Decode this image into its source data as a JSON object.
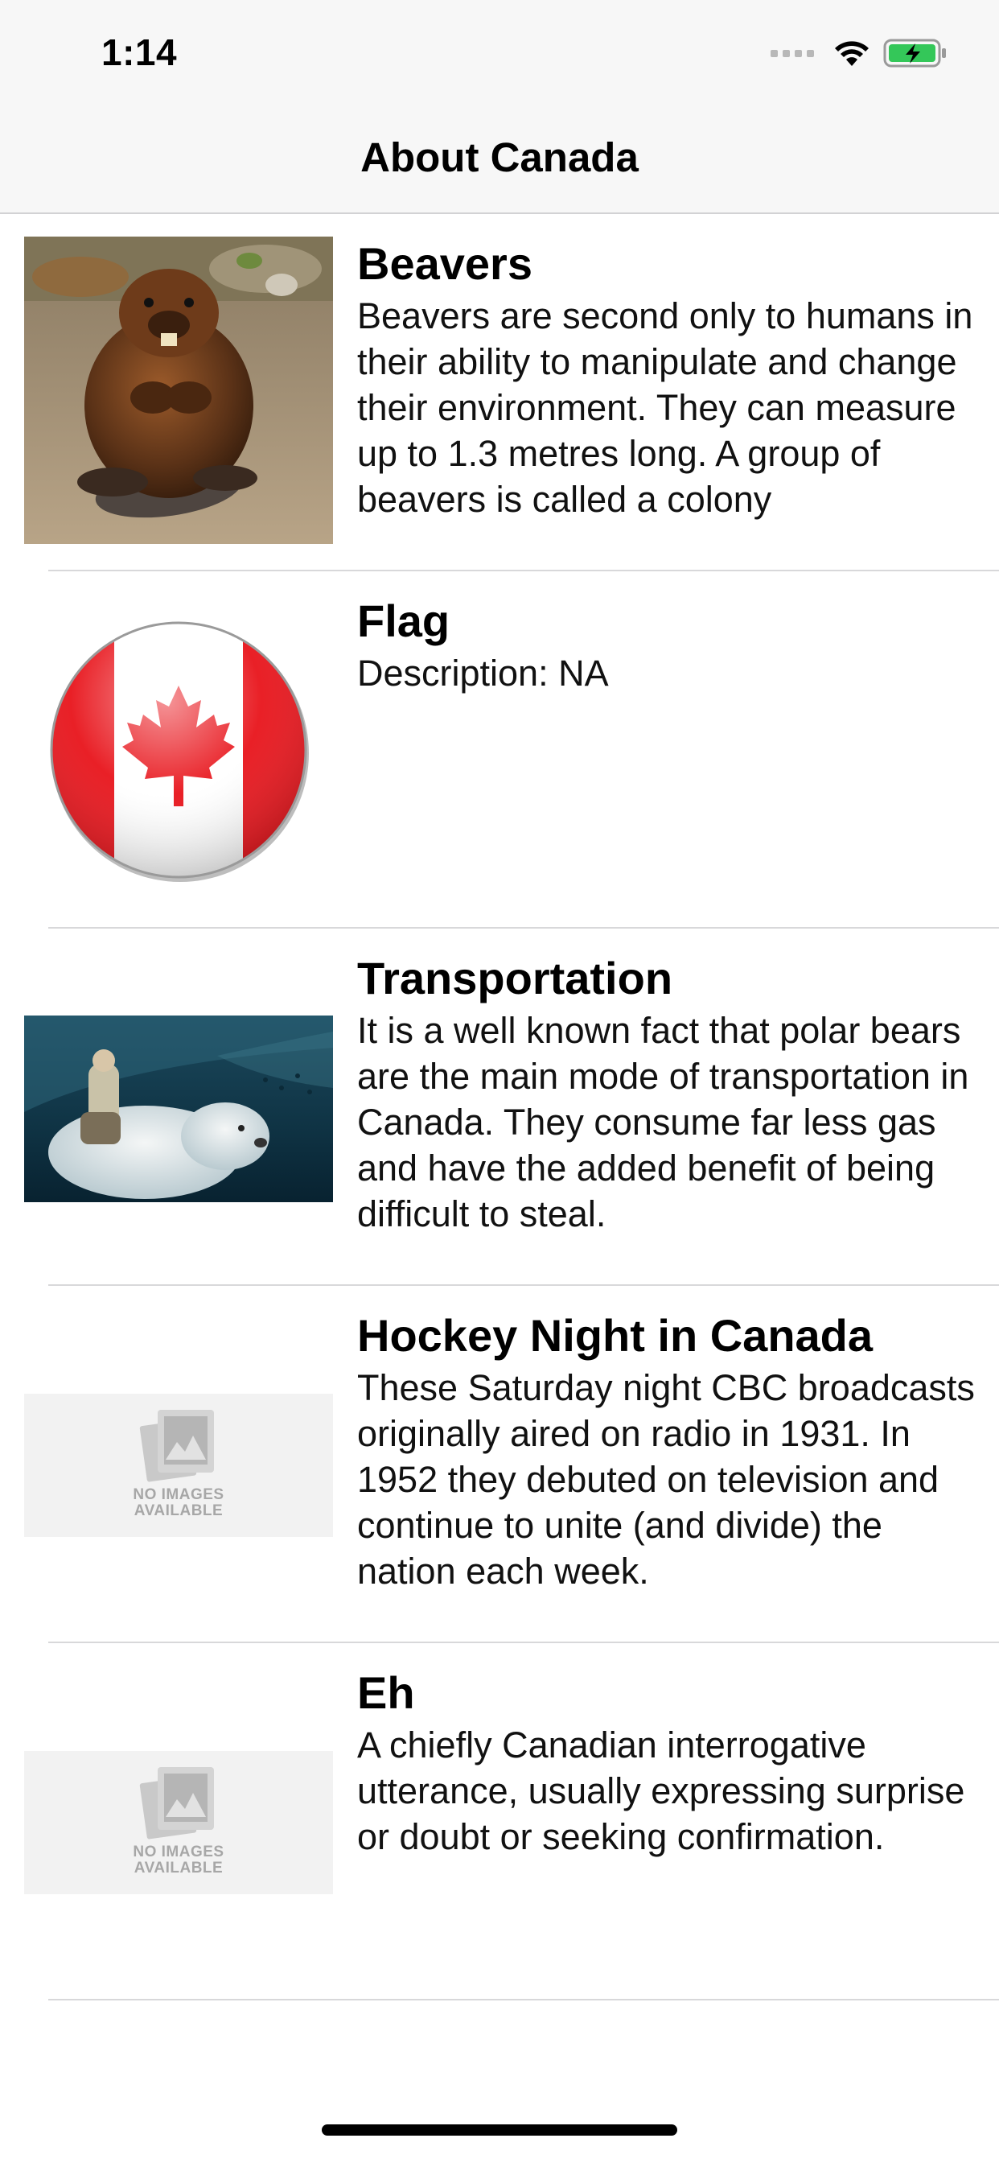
{
  "status_bar": {
    "time": "1:14",
    "wifi_icon": "wifi-icon",
    "battery_icon": "battery-charging-icon",
    "accent_battery": "#34c759"
  },
  "nav": {
    "title": "About Canada"
  },
  "rows": [
    {
      "title": "Beavers",
      "description": "Beavers are second only to humans in their ability to manipulate and change their environment. They can measure up to 1.3 metres long. A group of beavers is called a colony",
      "image": "beaver-photo"
    },
    {
      "title": "Flag",
      "description": "Description: NA",
      "image": "canada-flag-button"
    },
    {
      "title": "Transportation",
      "description": "It is a well known fact that polar bears are the main mode of transportation in Canada. They consume far less gas and have the added benefit of being difficult to steal.",
      "image": "polar-bear-photo"
    },
    {
      "title": "Hockey Night in Canada",
      "description": "These Saturday night CBC broadcasts originally aired on radio in 1931. In 1952 they debuted on television and continue to unite (and divide) the nation each week.",
      "image": "no-images-placeholder"
    },
    {
      "title": "Eh",
      "description": "A chiefly Canadian interrogative utterance, usually expressing surprise or doubt or seeking confirmation.",
      "image": "no-images-placeholder"
    }
  ],
  "placeholder_text": "NO IMAGES AVAILABLE",
  "colors": {
    "flag_red": "#e8141b",
    "nav_background": "#f7f7f7",
    "separator": "#d8d8da"
  }
}
